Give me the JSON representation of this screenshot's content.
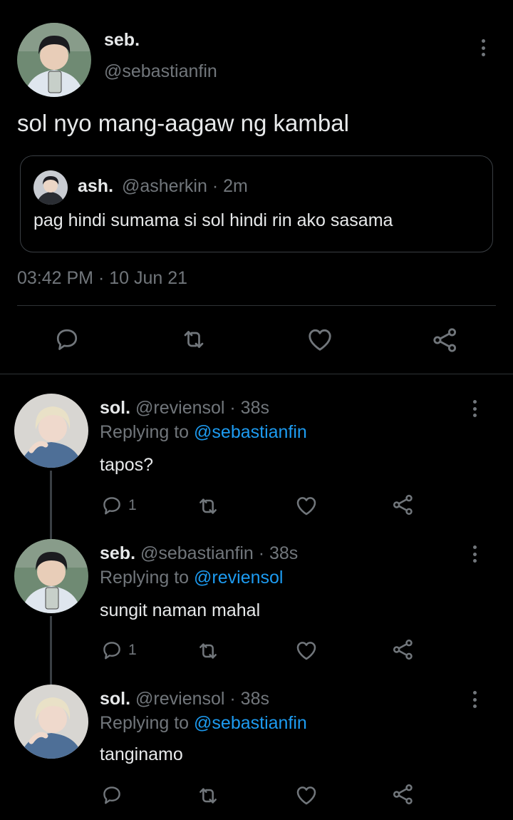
{
  "main_tweet": {
    "name": "seb.",
    "handle": "@sebastianfin",
    "text": "sol nyo mang-aagaw ng kambal",
    "quote": {
      "name": "ash.",
      "meta": "@asherkin · 2m",
      "text": "pag hindi sumama si sol hindi rin ako sasama"
    },
    "timestamp": "03:42 PM · 10 Jun 21"
  },
  "replies": [
    {
      "name": "sol.",
      "meta": "@reviensol · 38s",
      "replying_prefix": "Replying to",
      "replying_handle": "@sebastianfin",
      "text": "tapos?",
      "reply_count": "1"
    },
    {
      "name": "seb.",
      "meta": "@sebastianfin · 38s",
      "replying_prefix": "Replying to",
      "replying_handle": "@reviensol",
      "text": "sungit naman mahal",
      "reply_count": "1"
    },
    {
      "name": "sol.",
      "meta": "@reviensol · 38s",
      "replying_prefix": "Replying to",
      "replying_handle": "@sebastianfin",
      "text": "tanginamo",
      "reply_count": ""
    }
  ],
  "icons": {
    "reply": "speech-bubble-icon",
    "retweet": "retweet-icon",
    "like": "heart-icon",
    "share": "share-icon",
    "more": "more-vertical-icon"
  },
  "colors": {
    "background": "#000000",
    "text": "#e7e9ea",
    "muted": "#71767b",
    "link": "#1d9bf0",
    "divider": "#2f3336"
  }
}
